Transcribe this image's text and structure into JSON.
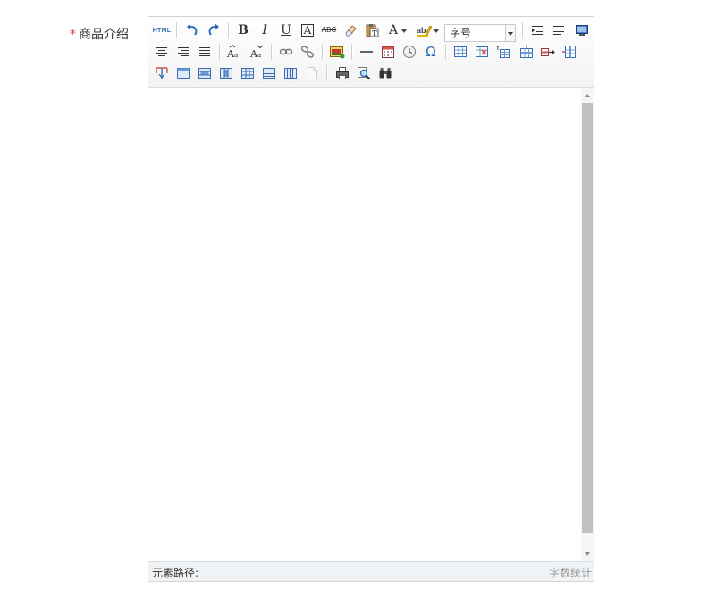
{
  "field": {
    "required_mark": "*",
    "label": "商品介绍"
  },
  "toolbar": {
    "html_label": "HTML",
    "bold": "B",
    "italic": "I",
    "underline": "U",
    "fontborder": "A",
    "strike": "ABC",
    "forecolor": "A",
    "fontsize_value": "字号",
    "autotype_glyph": "Aa",
    "omega": "Ω",
    "icons": [
      "html-source-icon",
      "undo-icon",
      "redo-icon",
      "bold-icon",
      "italic-icon",
      "underline-icon",
      "font-border-icon",
      "strikethrough-icon",
      "eraser-icon",
      "paste-text-icon",
      "font-color-icon",
      "background-color-icon",
      "font-size-select",
      "indent-icon",
      "align-left-icon",
      "preview-icon",
      "align-center-icon",
      "align-right-icon",
      "align-justify-icon",
      "letter-case-upper-icon",
      "letter-case-lower-icon",
      "link-icon",
      "unlink-icon",
      "insert-image-icon",
      "horizontal-rule-icon",
      "date-icon",
      "time-icon",
      "special-chars-icon",
      "insert-table-icon",
      "delete-table-icon",
      "insert-caption-icon",
      "insert-row-icon",
      "delete-row-icon",
      "insert-col-icon",
      "split-cells-icon",
      "merge-cells-icon",
      "merge-right-icon",
      "merge-down-icon",
      "split-to-rows-icon",
      "split-to-cols-icon",
      "delete-col-icon",
      "template-icon",
      "print-icon",
      "search-replace-icon",
      "find-binoculars-icon"
    ]
  },
  "content": {
    "text": ""
  },
  "statusbar": {
    "element_path": "元素路径:",
    "word_count": "字数统计"
  },
  "colors": {
    "accent": "#2f6db5",
    "required": "#e4393c",
    "toolbar_border": "#dcdcdc"
  }
}
